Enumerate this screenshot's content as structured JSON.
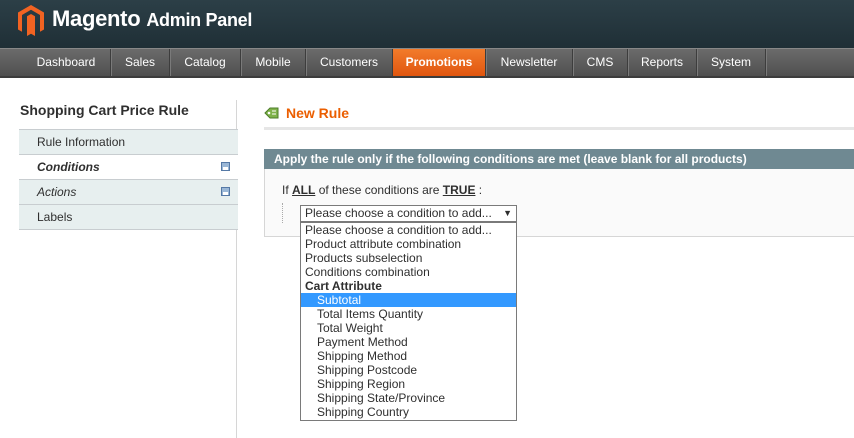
{
  "header": {
    "brand": "Magento",
    "brand_sub": "Admin Panel"
  },
  "nav": {
    "items": [
      "Dashboard",
      "Sales",
      "Catalog",
      "Mobile",
      "Customers",
      "Promotions",
      "Newsletter",
      "CMS",
      "Reports",
      "System"
    ],
    "active": "Promotions",
    "active_color": "#eb5e00"
  },
  "sidebar": {
    "title": "Shopping Cart Price Rule",
    "items": [
      {
        "label": "Rule Information"
      },
      {
        "label": "Conditions"
      },
      {
        "label": "Actions"
      },
      {
        "label": "Labels"
      }
    ]
  },
  "main": {
    "title": "New Rule",
    "fieldset_header": "Apply the rule only if the following conditions are met (leave blank for all products)",
    "cond_prefix": "If",
    "cond_all": "ALL",
    "cond_middle": "of these conditions are",
    "cond_true": "TRUE",
    "cond_suffix": ":",
    "select_value": "Please choose a condition to add...",
    "options": [
      {
        "label": "Please choose a condition to add...",
        "kind": "option"
      },
      {
        "label": "Product attribute combination",
        "kind": "option"
      },
      {
        "label": "Products subselection",
        "kind": "option"
      },
      {
        "label": "Conditions combination",
        "kind": "option"
      },
      {
        "label": "Cart Attribute",
        "kind": "group"
      },
      {
        "label": "Subtotal",
        "kind": "child",
        "selected": true
      },
      {
        "label": "Total Items Quantity",
        "kind": "child"
      },
      {
        "label": "Total Weight",
        "kind": "child"
      },
      {
        "label": "Payment Method",
        "kind": "child"
      },
      {
        "label": "Shipping Method",
        "kind": "child"
      },
      {
        "label": "Shipping Postcode",
        "kind": "child"
      },
      {
        "label": "Shipping Region",
        "kind": "child"
      },
      {
        "label": "Shipping State/Province",
        "kind": "child"
      },
      {
        "label": "Shipping Country",
        "kind": "child"
      }
    ]
  }
}
